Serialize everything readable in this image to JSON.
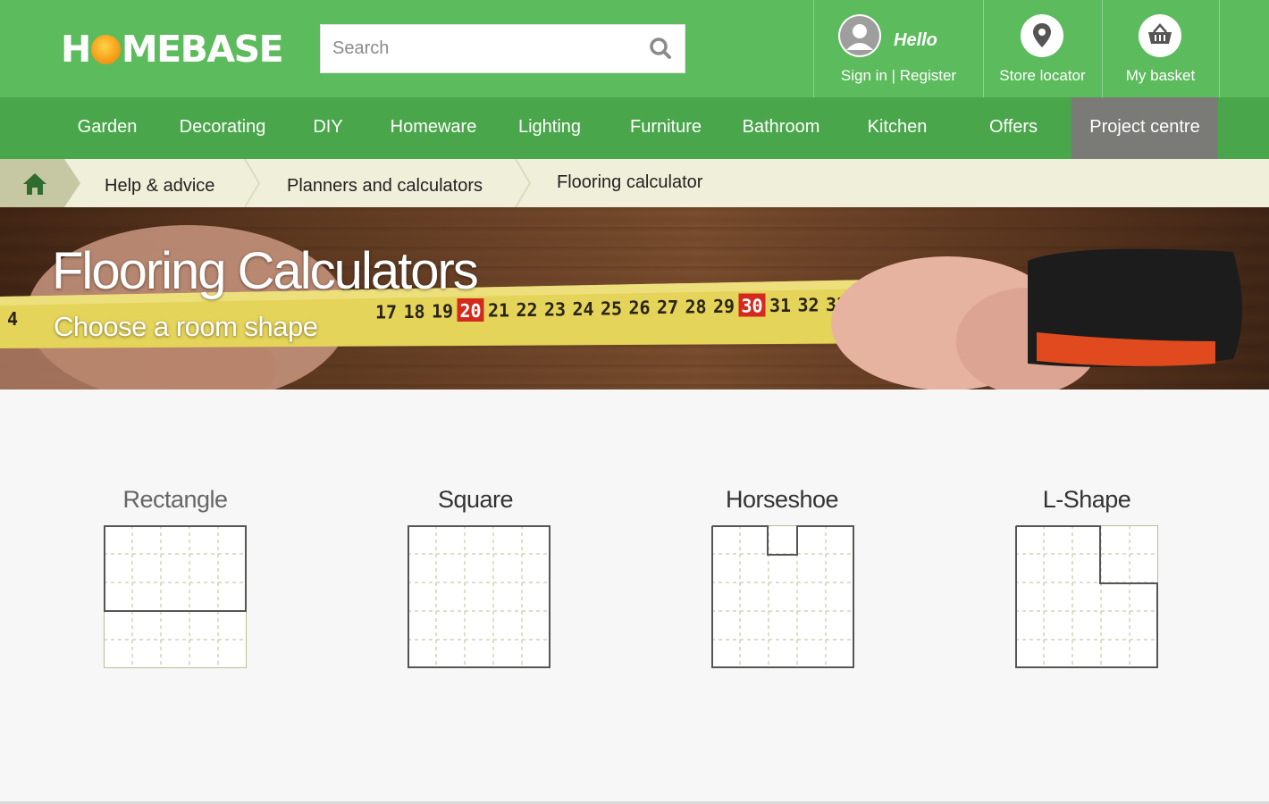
{
  "header": {
    "logo_text_left": "H",
    "logo_text_right": "MEBASE",
    "search_placeholder": "Search",
    "account": {
      "greeting": "Hello",
      "sign_in_label": "Sign in | Register"
    },
    "store_locator_label": "Store locator",
    "basket_label": "My basket"
  },
  "nav": {
    "items": [
      {
        "label": "Garden"
      },
      {
        "label": "Decorating"
      },
      {
        "label": "DIY"
      },
      {
        "label": "Homeware"
      },
      {
        "label": "Lighting"
      },
      {
        "label": "Furniture"
      },
      {
        "label": "Bathroom"
      },
      {
        "label": "Kitchen"
      },
      {
        "label": "Offers"
      },
      {
        "label": "Project centre"
      }
    ],
    "active_label": "Project centre"
  },
  "breadcrumb": {
    "items": [
      {
        "label": "Help & advice"
      },
      {
        "label": "Planners and calculators"
      },
      {
        "label": "Flooring calculator"
      }
    ]
  },
  "hero": {
    "title": "Flooring Calculators",
    "subtitle": "Choose a room shape",
    "tape_numbers": [
      "4",
      "17",
      "18",
      "19",
      "20",
      "21",
      "22",
      "23",
      "24",
      "25",
      "26",
      "27",
      "28",
      "29",
      "30",
      "31",
      "32",
      "33"
    ]
  },
  "shapes": [
    {
      "label": "Rectangle"
    },
    {
      "label": "Square"
    },
    {
      "label": "Horseshoe"
    },
    {
      "label": "L-Shape"
    }
  ],
  "colors": {
    "header_green": "#5cbb5d",
    "nav_green": "#4aa64b",
    "active_nav": "#7a7a76",
    "breadcrumb_bg": "#f0efda",
    "grid_line": "#b8bf92",
    "outline": "#555555"
  }
}
